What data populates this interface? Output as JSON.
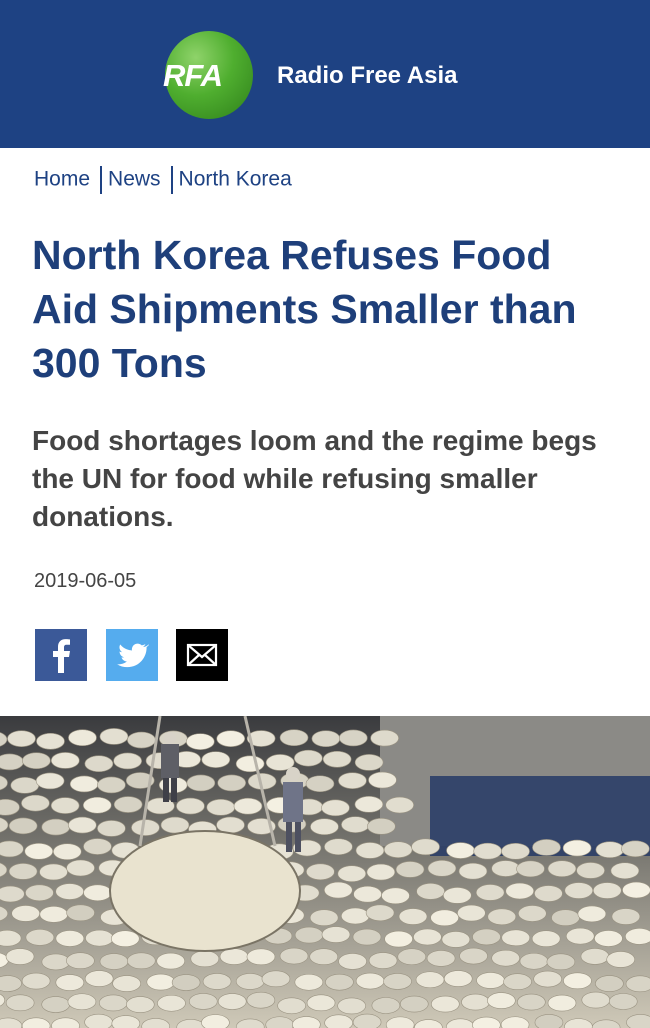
{
  "header": {
    "logo_text": "RFA",
    "brand_name": "Radio Free Asia",
    "background_color": "#1e4283",
    "logo_color": "#4fae2f"
  },
  "breadcrumb": [
    "Home",
    "News",
    "North Korea"
  ],
  "article": {
    "title": "North Korea Refuses Food Aid Shipments Smaller than 300 Tons",
    "subtitle": "Food shortages loom and the regime begs the UN for food while refusing smaller donations.",
    "date": "2019-06-05"
  },
  "share": {
    "facebook_icon": "facebook-icon",
    "twitter_icon": "twitter-icon",
    "email_icon": "email-icon",
    "facebook_color": "#3b5998",
    "twitter_color": "#55acee",
    "email_color": "#000000"
  },
  "photo": {
    "subject": "warehouse-rice-sacks"
  }
}
